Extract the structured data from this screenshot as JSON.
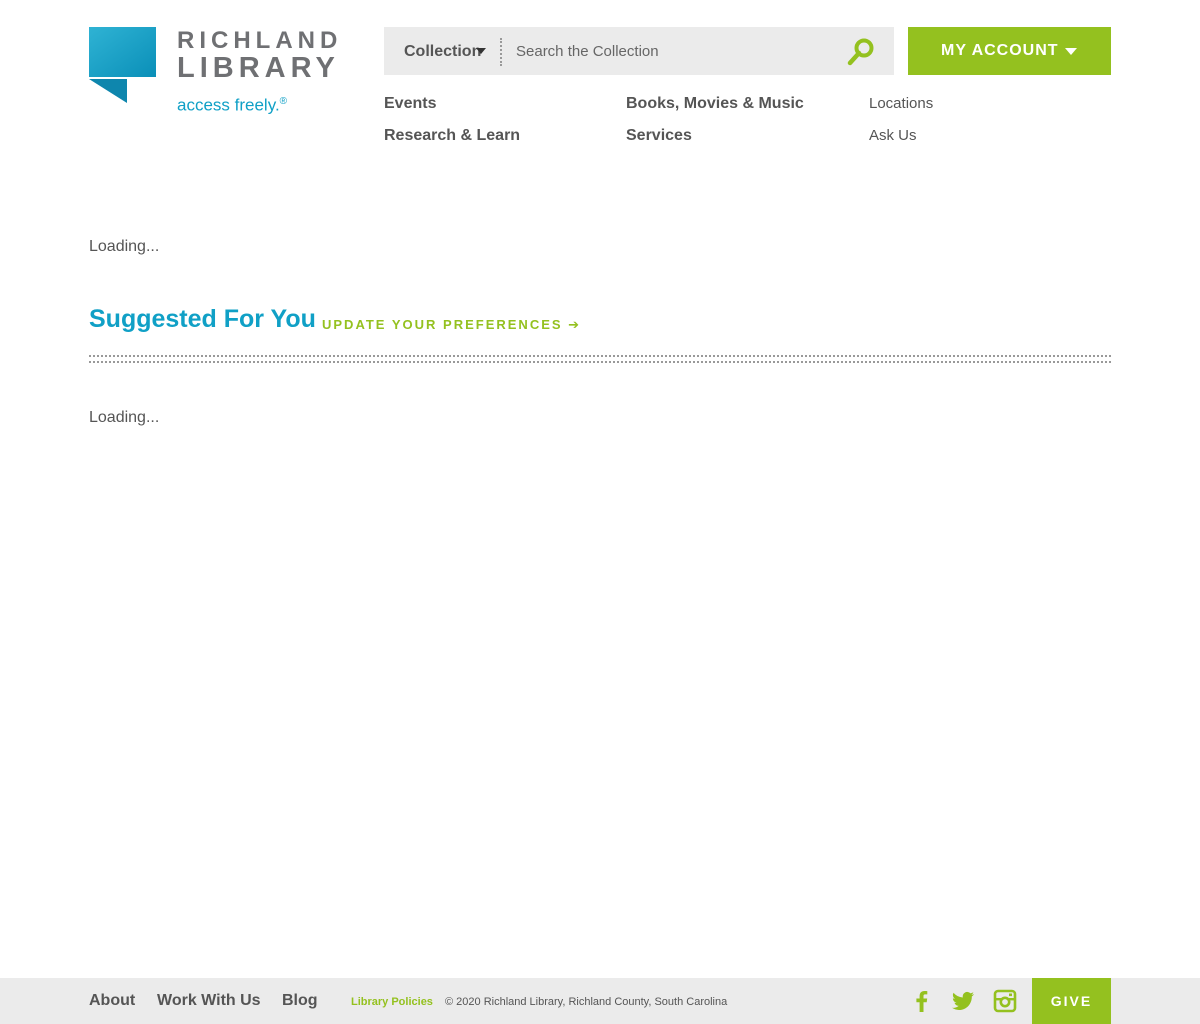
{
  "brand": {
    "name_line1": "RICHLAND",
    "name_line2": "LIBRARY",
    "tagline": "access freely.",
    "tagline_mark": "®",
    "colors": {
      "teal": "#10a0c6",
      "green": "#94c11f",
      "gray": "#6f7073"
    }
  },
  "search": {
    "scope": "Collection",
    "placeholder": "Search the Collection",
    "button_icon": "search-icon"
  },
  "account": {
    "label": "MY ACCOUNT"
  },
  "nav": {
    "events": "Events",
    "books": "Books, Movies & Music",
    "locations": "Locations",
    "research": "Research & Learn",
    "services": "Services",
    "ask": "Ask Us"
  },
  "main": {
    "loading_top": "Loading...",
    "suggested_title": "Suggested For You",
    "preferences_link": "UPDATE YOUR PREFERENCES ➔",
    "loading_bottom": "Loading..."
  },
  "footer": {
    "about": "About",
    "work": "Work With Us",
    "blog": "Blog",
    "policies": "Library Policies",
    "copyright": "© 2020 Richland Library, Richland County, South Carolina",
    "social": [
      "facebook-icon",
      "twitter-icon",
      "instagram-icon"
    ],
    "give": "GIVE"
  }
}
